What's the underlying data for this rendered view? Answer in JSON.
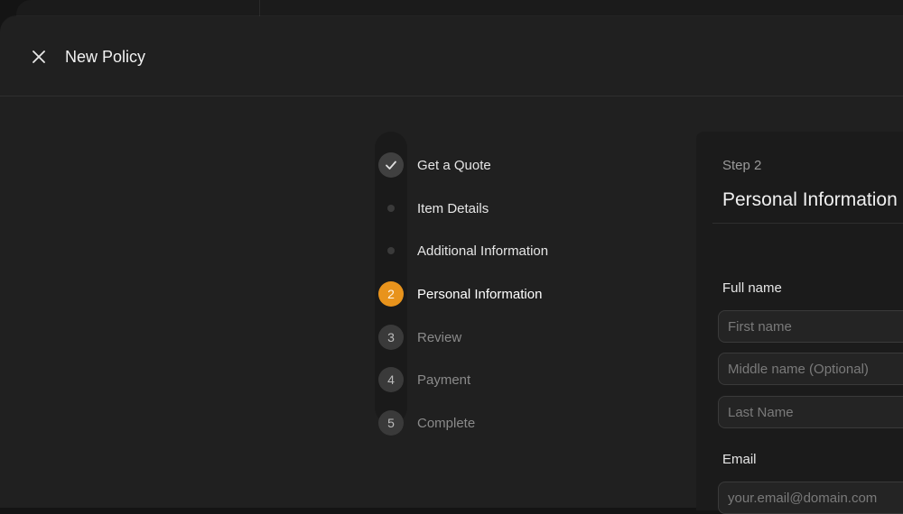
{
  "header": {
    "title": "New Policy",
    "close_icon": "close-icon"
  },
  "stepper": {
    "steps": [
      {
        "label": "Get a Quote",
        "state": "complete",
        "marker": "check-icon"
      },
      {
        "label": "Item Details",
        "state": "complete",
        "marker": "dot"
      },
      {
        "label": "Additional Information",
        "state": "complete",
        "marker": "dot"
      },
      {
        "label": "Personal Information",
        "state": "active",
        "marker": "2"
      },
      {
        "label": "Review",
        "state": "upcoming",
        "marker": "3"
      },
      {
        "label": "Payment",
        "state": "upcoming",
        "marker": "4"
      },
      {
        "label": "Complete",
        "state": "upcoming",
        "marker": "5"
      }
    ],
    "active_color": "#e8931c"
  },
  "form": {
    "step_kicker": "Step 2",
    "title": "Personal Information",
    "full_name_label": "Full name",
    "first_name_placeholder": "First name",
    "middle_name_placeholder": "Middle name (Optional)",
    "last_name_placeholder": "Last Name",
    "email_label": "Email",
    "email_placeholder": "your.email@domain.com"
  }
}
